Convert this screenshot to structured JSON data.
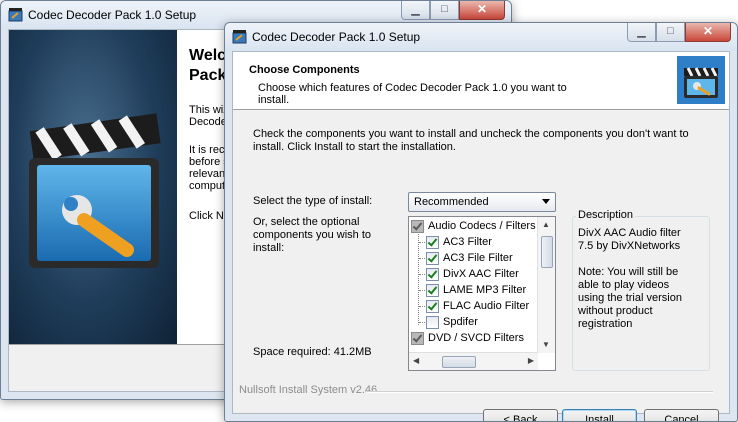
{
  "back_window": {
    "title": "Codec Decoder Pack 1.0 Setup",
    "welcome_title": "Welco\nPack",
    "paragraphs": [
      "This wiz\nDecoder",
      "It is reco\nbefore s\nrelevant\ncompute",
      "Click Ne"
    ]
  },
  "front_window": {
    "title": "Codec Decoder Pack 1.0 Setup",
    "header_title": "Choose Components",
    "header_subtitle": "Choose which features of Codec Decoder Pack 1.0 you want to install.",
    "instructions": "Check the components you want to install and uncheck the components you don't want to install. Click Install to start the installation.",
    "install_type_label": "Select the type of install:",
    "install_type_value": "Recommended",
    "optional_label": "Or, select the optional components you wish to install:",
    "space_required": "Space required: 41.2MB",
    "components": [
      {
        "label": "Audio Codecs / Filters",
        "level": 0,
        "checked": true,
        "partial": true
      },
      {
        "label": "AC3 Filter",
        "level": 1,
        "checked": true
      },
      {
        "label": "AC3 File Filter",
        "level": 1,
        "checked": true
      },
      {
        "label": "DivX AAC Filter",
        "level": 1,
        "checked": true
      },
      {
        "label": "LAME MP3 Filter",
        "level": 1,
        "checked": true
      },
      {
        "label": "FLAC Audio Filter",
        "level": 1,
        "checked": true
      },
      {
        "label": "Spdifer",
        "level": 1,
        "checked": false
      },
      {
        "label": "DVD / SVCD Filters",
        "level": 0,
        "checked": true,
        "partial": true
      }
    ],
    "description_title": "Description",
    "description_text": "DivX AAC Audio filter\n7.5 by DivXNetworks\n\nNote: You will still be\nable to play videos\nusing the trial version\nwithout product\nregistration",
    "branding": "Nullsoft Install System v2.46",
    "buttons": {
      "back": "< Back",
      "install": "Install",
      "cancel": "Cancel"
    }
  },
  "colors": {
    "accent": "#3c7fb1",
    "check_green": "#1a7f1a",
    "close_red": "#c9473a"
  }
}
